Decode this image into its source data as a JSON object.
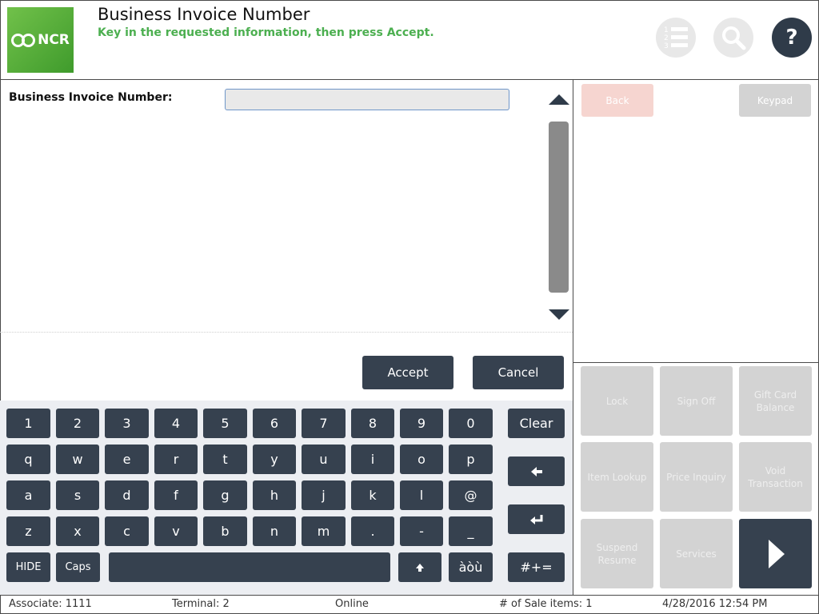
{
  "header": {
    "logo_text": "NCR",
    "title": "Business Invoice Number",
    "subtitle": "Key in the requested information, then press Accept.",
    "icons": [
      "numbered-list-icon",
      "search-icon",
      "help-icon"
    ],
    "help_glyph": "?"
  },
  "form": {
    "field_label": "Business Invoice Number:",
    "field_value": "",
    "field_placeholder": ""
  },
  "actions": {
    "accept": "Accept",
    "cancel": "Cancel"
  },
  "keyboard": {
    "row1": [
      "1",
      "2",
      "3",
      "4",
      "5",
      "6",
      "7",
      "8",
      "9",
      "0"
    ],
    "row2": [
      "q",
      "w",
      "e",
      "r",
      "t",
      "y",
      "u",
      "i",
      "o",
      "p"
    ],
    "row3": [
      "a",
      "s",
      "d",
      "f",
      "g",
      "h",
      "j",
      "k",
      "l",
      "@"
    ],
    "row4": [
      "z",
      "x",
      "c",
      "v",
      "b",
      "n",
      "m",
      ".",
      "-",
      "_"
    ],
    "hide": "HIDE",
    "caps": "Caps",
    "accents": "àòù",
    "clear": "Clear",
    "symbols": "#+="
  },
  "right_panel": {
    "back": "Back",
    "keypad": "Keypad",
    "tiles": [
      "Lock",
      "Sign Off",
      "Gift Card Balance",
      "Item Lookup",
      "Price Inquiry",
      "Void Transaction",
      "Suspend Resume",
      "Services"
    ]
  },
  "status_bar": {
    "associate": "Associate: 1111",
    "terminal": "Terminal: 2",
    "connection": "Online",
    "sale_items": "# of Sale items: 1",
    "datetime": "4/28/2016 12:54 PM"
  },
  "colors": {
    "accent_green": "#4caf50",
    "button_dark": "#36414f",
    "disabled_gray": "#d3d3d3"
  }
}
